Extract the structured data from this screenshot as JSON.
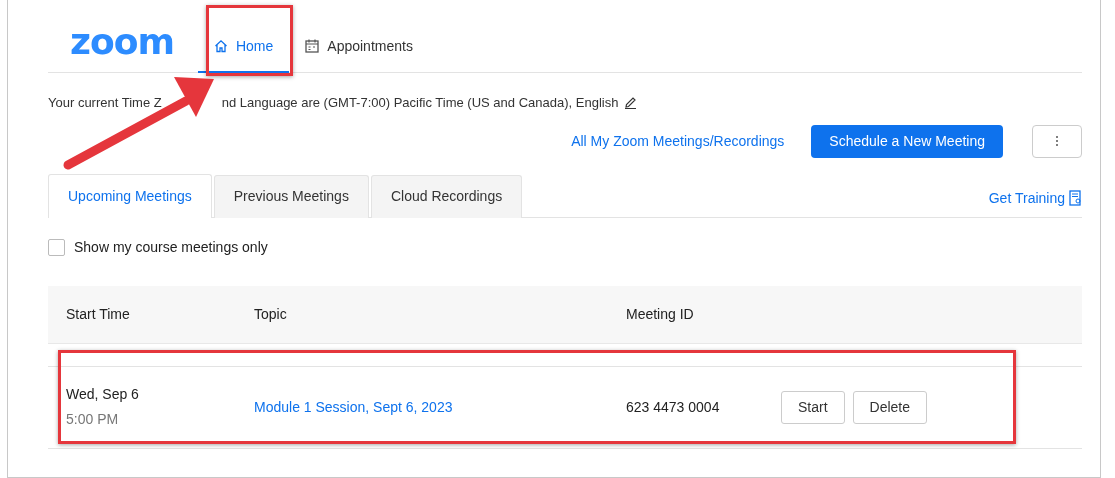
{
  "nav": {
    "logo": "zoom",
    "tabs": [
      {
        "label": "Home",
        "selected": true,
        "highlighted": true
      },
      {
        "label": "Appointments",
        "selected": false,
        "highlighted": false
      }
    ]
  },
  "timezone_notice": {
    "text_before": "Your current Time Z",
    "text_after": "nd Language are (GMT-7:00) Pacific Time (US and Canada), English"
  },
  "callout_arrow": true,
  "actions": {
    "link": "All My Zoom Meetings/Recordings",
    "primary_button": "Schedule a New Meeting"
  },
  "meeting_tabs": [
    {
      "label": "Upcoming Meetings",
      "selected": true
    },
    {
      "label": "Previous Meetings",
      "selected": false
    },
    {
      "label": "Cloud Recordings",
      "selected": false
    }
  ],
  "training_link": "Get Training",
  "filter": {
    "label": "Show my course meetings only",
    "checked": false
  },
  "table": {
    "columns": [
      "Start Time",
      "Topic",
      "Meeting ID"
    ],
    "rows": [
      {
        "date": "Wed, Sep 6",
        "time": "5:00 PM",
        "topic": "Module 1 Session, Sept 6, 2023",
        "meeting_id": "623 4473 0004",
        "actions": [
          "Start",
          "Delete"
        ],
        "highlighted": true
      }
    ]
  }
}
